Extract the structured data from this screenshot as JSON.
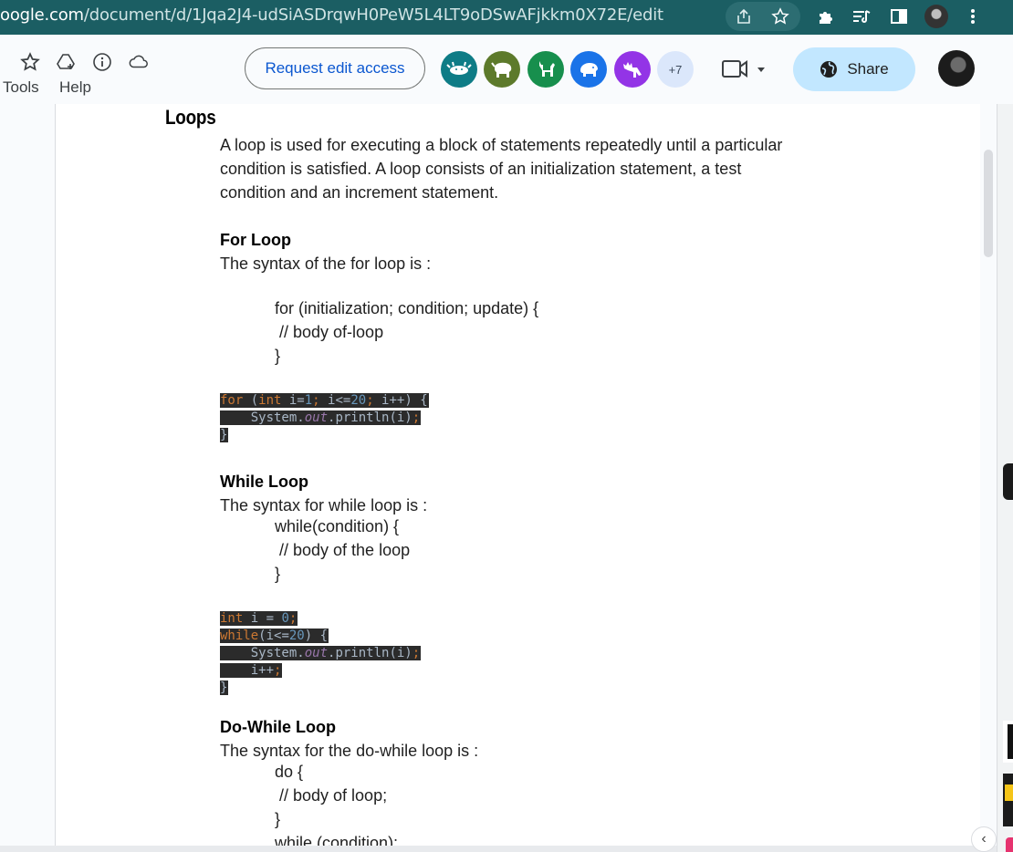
{
  "browser": {
    "url_host": "oogle.com",
    "url_path": "/document/d/1Jqa2J4-udSiASDrqwH0PeW5L4LT9oDSwAFjkkm0X72E/edit",
    "icons": [
      "share-page-icon",
      "bookmark-star-icon",
      "extensions-puzzle-icon",
      "reading-list-icon",
      "side-panel-icon",
      "profile-avatar",
      "kebab-menu-icon"
    ]
  },
  "docs_toolbar": {
    "menu_items": [
      "Tools",
      "Help"
    ],
    "request_edit_label": "Request edit access",
    "viewers_more": "+7",
    "share_label": "Share",
    "anonymous_viewers": [
      {
        "icon": "anonymous-axolotl-icon",
        "color": "#0e7c86"
      },
      {
        "icon": "anonymous-buffalo-icon",
        "color": "#5d7a2b"
      },
      {
        "icon": "anonymous-llama-icon",
        "color": "#178f4d"
      },
      {
        "icon": "anonymous-capybara-icon",
        "color": "#1a73e8"
      },
      {
        "icon": "anonymous-moose-icon",
        "color": "#9334e6"
      }
    ]
  },
  "document": {
    "heading": "Loops",
    "intro": [
      "A loop is used for executing a block of statements repeatedly until a particular",
      "condition is satisfied. A loop consists of an initialization statement, a test",
      "condition and an increment statement."
    ],
    "for": {
      "title": "For Loop",
      "syntax_intro": "The syntax of the for loop is  :",
      "syntax": [
        "for (initialization; condition; update) {",
        " // body of-loop",
        "}"
      ]
    },
    "while": {
      "title": "While Loop",
      "syntax_intro": "The syntax for while loop is :",
      "syntax": [
        "while(condition) {",
        " // body of the loop",
        "}"
      ]
    },
    "dowhile": {
      "title": "Do-While Loop",
      "syntax_intro": "The syntax for the do-while loop is :",
      "syntax": [
        "do {",
        " // body of loop;",
        "}",
        "while (condition);"
      ]
    }
  }
}
